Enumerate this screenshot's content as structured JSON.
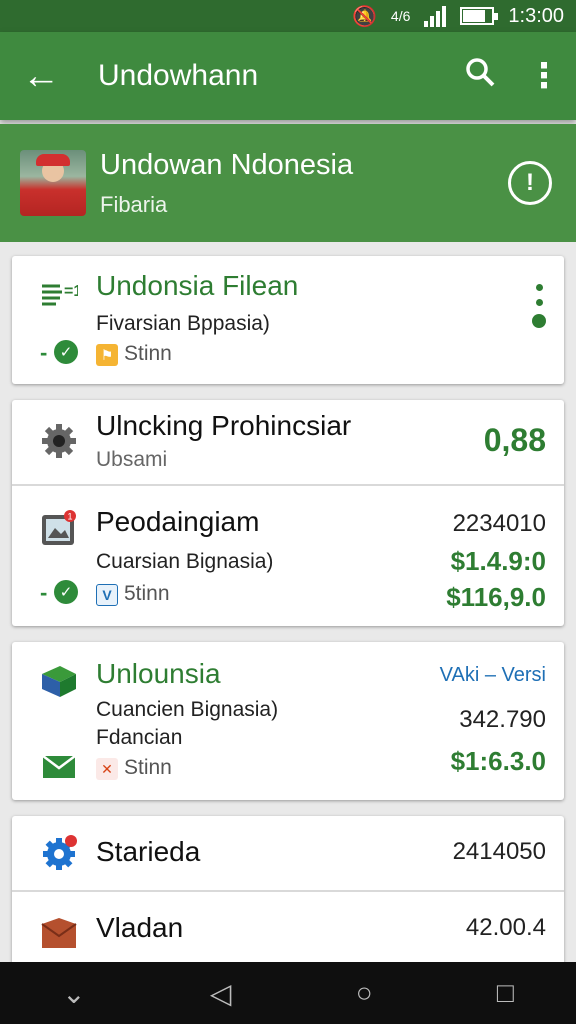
{
  "status": {
    "time": "1:3:00",
    "net": "4/6"
  },
  "appbar": {
    "back": "←",
    "title": "Undowhann",
    "search": "⌕",
    "more": "⋮"
  },
  "profile": {
    "name": "Undowan Ndonesia",
    "subtitle": "Fibaria",
    "info": "!"
  },
  "card1": {
    "title": "Undonsia Filean",
    "subtitle": "Fivarsian Bppasia)",
    "status": "Stinn"
  },
  "card2": {
    "row1": {
      "title": "Ulncking Prohincsiar",
      "subtitle": "Ubsami",
      "value": "0,88"
    },
    "row2": {
      "title": "Peodaingiam",
      "subtitle": "Cuarsian Bignasia)",
      "status": "5tinn",
      "v1": "2234010",
      "v2": "$1.4.9:0",
      "v3": "$116,9.0"
    }
  },
  "card3": {
    "title": "Unlounsia",
    "line1": "Cuancien Bignasia)",
    "line2": "Fdancian",
    "status": "Stinn",
    "tag": "VAki – Versi",
    "v1": "342.790",
    "v2": "$1:6.3.0"
  },
  "card4": {
    "row1": {
      "title": "Starieda",
      "value": "2414050"
    },
    "row2": {
      "title": "Vladan",
      "value": "42.00.4"
    }
  },
  "nav": {
    "down": "⌄",
    "back": "◁",
    "home": "○",
    "recent": "□"
  }
}
